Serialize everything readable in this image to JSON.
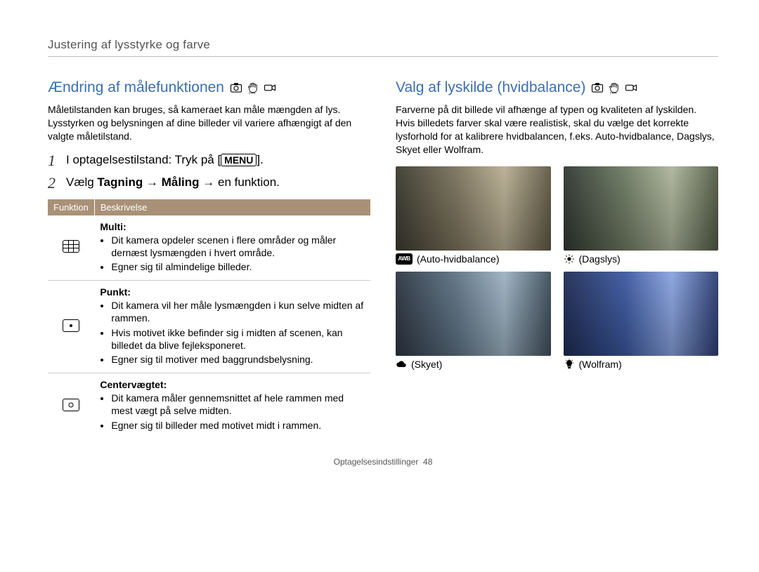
{
  "header": {
    "title": "Justering af lysstyrke og farve"
  },
  "left": {
    "title": "Ændring af målefunktionen",
    "intro": "Måletilstanden kan bruges, så kameraet kan måle mængden af lys. Lysstyrken og belysningen af dine billeder vil variere afhængigt af den valgte måletilstand.",
    "step1_a": "I optagelsestilstand: Tryk på [",
    "step1_menu": "MENU",
    "step1_b": "].",
    "step2_a": "Vælg ",
    "step2_b": "Tagning",
    "step2_c": " → ",
    "step2_d": "Måling",
    "step2_e": " → en funktion.",
    "table": {
      "col1": "Funktion",
      "col2": "Beskrivelse",
      "rows": [
        {
          "name": "Multi",
          "b1": "Dit kamera opdeler scenen i flere områder og måler dernæst lysmængden i hvert område.",
          "b2": "Egner sig til almindelige billeder."
        },
        {
          "name": "Punkt",
          "b1": "Dit kamera vil her måle lysmængden i kun selve midten af rammen.",
          "b2": "Hvis motivet ikke befinder sig i midten af scenen, kan billedet da blive fejleksponeret.",
          "b3": "Egner sig til motiver med baggrundsbelysning."
        },
        {
          "name": "Centervægtet",
          "b1": "Dit kamera måler gennemsnittet af hele rammen med mest vægt på selve midten.",
          "b2": "Egner sig til billeder med motivet midt i rammen."
        }
      ]
    }
  },
  "right": {
    "title": "Valg af lyskilde (hvidbalance)",
    "intro": "Farverne på dit billede vil afhænge af typen og kvaliteten af lyskilden. Hvis billedets farver skal være realistisk, skal du vælge det korrekte lysforhold for at kalibrere hvidbalancen, f.eks. Auto-hvidbalance, Dagslys, Skyet eller Wolfram.",
    "wb": {
      "auto_badge": "AWB",
      "auto": "(Auto-hvidbalance)",
      "day": "(Dagslys)",
      "cloud": "(Skyet)",
      "tung": "(Wolfram)"
    }
  },
  "footer": {
    "section": "Optagelsesindstillinger",
    "page": "48"
  }
}
